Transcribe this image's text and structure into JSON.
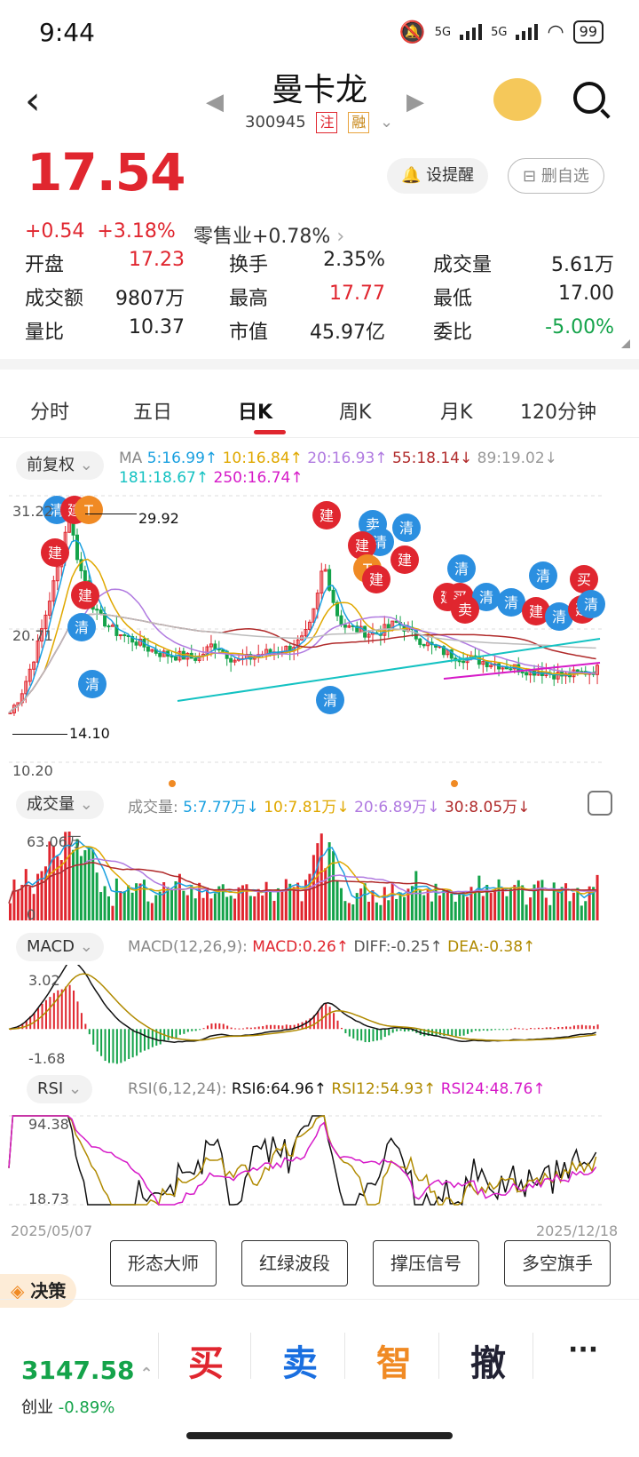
{
  "status": {
    "time": "9:44",
    "signal1": "5G",
    "signal2": "5G",
    "battery": "99"
  },
  "header": {
    "name": "曼卡龙",
    "code": "300945",
    "tag1": "注",
    "tag2": "融"
  },
  "quote": {
    "price": "17.54",
    "change": "+0.54",
    "change_pct": "+3.18%",
    "sector": "零售业+0.78%",
    "alert_btn": "设提醒",
    "remove_btn": "删自选"
  },
  "stats": [
    {
      "k": "开盘",
      "v": "17.23",
      "c": "red"
    },
    {
      "k": "换手",
      "v": "2.35%",
      "c": ""
    },
    {
      "k": "成交量",
      "v": "5.61万",
      "c": ""
    },
    {
      "k": "成交额",
      "v": "9807万",
      "c": ""
    },
    {
      "k": "最高",
      "v": "17.77",
      "c": "red"
    },
    {
      "k": "最低",
      "v": "17.00",
      "c": ""
    },
    {
      "k": "量比",
      "v": "10.37",
      "c": ""
    },
    {
      "k": "市值",
      "v": "45.97亿",
      "c": ""
    },
    {
      "k": "委比",
      "v": "-5.00%",
      "c": "green"
    }
  ],
  "tabs": [
    "分时",
    "五日",
    "日K",
    "周K",
    "月K",
    "120分钟"
  ],
  "kline": {
    "adjust": "前复权",
    "ma_label": "MA",
    "ma5": "5:16.99↑",
    "ma10": "10:16.84↑",
    "ma20": "20:16.93↑",
    "ma55": "55:18.14↓",
    "ma89": "89:19.02↓",
    "ma181": "181:18.67↑",
    "ma250": "250:16.74↑",
    "y_top": "31.22",
    "y_mid": "20.71",
    "y_bot": "10.20",
    "high_mark": "29.92",
    "low_mark": "14.10"
  },
  "volume": {
    "chip": "成交量",
    "label": "成交量:",
    "v5": "5:7.77万↓",
    "v10": "10:7.81万↓",
    "v20": "20:6.89万↓",
    "v30": "30:8.05万↓",
    "y_top": "63.06万",
    "y_bot": "0"
  },
  "macd": {
    "chip": "MACD",
    "params": "MACD(12,26,9):",
    "macd": "MACD:0.26↑",
    "diff": "DIFF:-0.25↑",
    "dea": "DEA:-0.38↑",
    "y_top": "3.02",
    "y_bot": "-1.68"
  },
  "rsi": {
    "chip": "RSI",
    "params": "RSI(6,12,24):",
    "rsi6": "RSI6:64.96↑",
    "rsi12": "RSI12:54.93↑",
    "rsi24": "RSI24:48.76↑",
    "y_top": "94.38",
    "y_bot": "18.73"
  },
  "dates": {
    "start": "2025/05/07",
    "end": "2025/12/18"
  },
  "tools": {
    "decision": "决策",
    "btns": [
      "形态大师",
      "红绿波段",
      "撑压信号",
      "多空旗手"
    ]
  },
  "bottom": {
    "index_value": "3147.58",
    "index_name": "创业",
    "index_change": "-0.89%",
    "buy": "买",
    "sell": "卖",
    "smart": "智",
    "cancel": "撤",
    "more": "···"
  },
  "markers": {
    "qing": "清",
    "jian": "建",
    "mai": "卖",
    "buy": "买",
    "t": "T"
  },
  "colors": {
    "up": "#e0262f",
    "down": "#14a34a",
    "accent": "#e0262f"
  }
}
